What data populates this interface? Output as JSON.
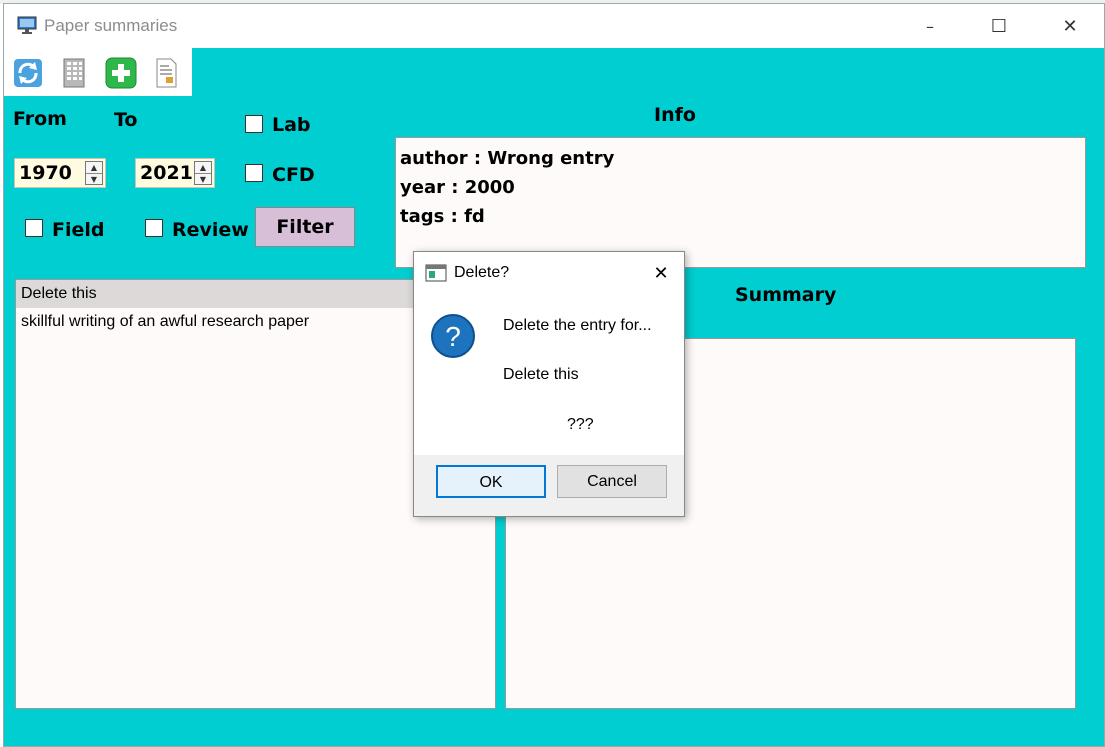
{
  "window": {
    "title": "Paper summaries",
    "controls": {
      "minimize": "–",
      "maximize": "☐",
      "close": "✕"
    }
  },
  "toolbar": {
    "icons": [
      "refresh-icon",
      "database-icon",
      "add-icon",
      "document-icon"
    ]
  },
  "filters": {
    "from_label": "From",
    "to_label": "To",
    "from_value": "1970",
    "to_value": "2021",
    "checkboxes": {
      "lab": "Lab",
      "cfd": "CFD",
      "field": "Field",
      "review": "Review"
    },
    "filter_button": "Filter"
  },
  "info": {
    "heading": "Info",
    "lines": [
      "author : Wrong entry",
      "year : 2000",
      "tags : fd"
    ]
  },
  "summary": {
    "heading": "Summary"
  },
  "list": {
    "items": [
      "Delete this",
      "skillful writing of an awful research paper"
    ],
    "selected_index": 0
  },
  "dialog": {
    "title": "Delete?",
    "line1": "Delete the entry for...",
    "line2": "Delete this",
    "line3": "???",
    "ok": "OK",
    "cancel": "Cancel",
    "close": "✕"
  },
  "colors": {
    "window_bg": "#00ced1",
    "panel_bg": "#fffafa",
    "spin_bg": "#fffbe0",
    "filter_button_bg": "#d8bfd8",
    "dialog_icon": "#1e73be"
  }
}
